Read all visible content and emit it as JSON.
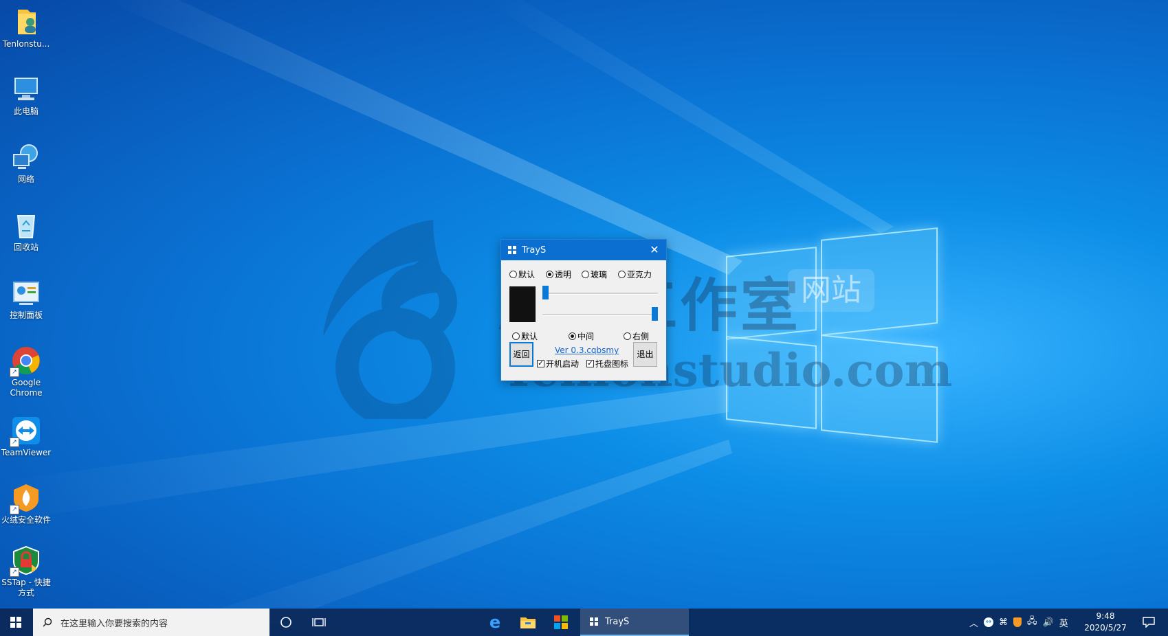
{
  "desktop": {
    "icons": [
      {
        "label": "Tenlonstu...",
        "icon": "user-folder-icon"
      },
      {
        "label": "此电脑",
        "icon": "computer-icon"
      },
      {
        "label": "网络",
        "icon": "network-icon"
      },
      {
        "label": "回收站",
        "icon": "recycle-bin-icon"
      },
      {
        "label": "控制面板",
        "icon": "control-panel-icon"
      },
      {
        "label": "Google Chrome",
        "icon": "chrome-icon"
      },
      {
        "label": "TeamViewer",
        "icon": "teamviewer-icon"
      },
      {
        "label": "火绒安全软件",
        "icon": "huorong-icon"
      },
      {
        "label": "SSTap - 快捷方式",
        "icon": "sstap-icon"
      }
    ],
    "watermark": {
      "cn": "腾龙工作室",
      "site": "网站",
      "en": "Tenlonstudio.com"
    }
  },
  "dialog": {
    "title": "TrayS",
    "style_options": [
      {
        "label": "默认",
        "selected": false
      },
      {
        "label": "透明",
        "selected": true
      },
      {
        "label": "玻璃",
        "selected": false
      },
      {
        "label": "亚克力",
        "selected": false
      }
    ],
    "position_options": [
      {
        "label": "默认",
        "selected": false
      },
      {
        "label": "中间",
        "selected": true
      },
      {
        "label": "右侧",
        "selected": false
      }
    ],
    "swatch_color": "#111111",
    "slider_top_fraction": 0.0,
    "slider_bottom_fraction": 1.0,
    "back_label": "返回",
    "version_link": "Ver 0.3.cqbsmy",
    "exit_label": "退出",
    "autostart_label": "开机启动",
    "autostart_checked": true,
    "tray_icon_label": "托盘图标",
    "tray_icon_checked": true
  },
  "taskbar": {
    "search_placeholder": "在这里输入你要搜索的内容",
    "active_app": "TrayS",
    "ime": "英",
    "time": "9:48",
    "date": "2020/5/27"
  }
}
